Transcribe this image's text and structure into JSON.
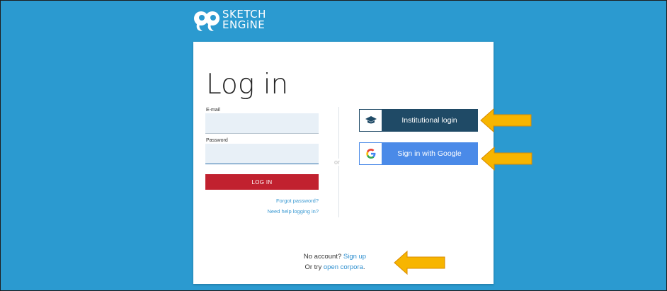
{
  "brand": {
    "line1": "SKETCH",
    "line2": "ENGiNE"
  },
  "login": {
    "title": "Log in",
    "email_label": "E-mail",
    "email_value": "",
    "password_label": "Password",
    "password_value": "",
    "submit_label": "LOG IN",
    "forgot_label": "Forgot password?",
    "help_label": "Need help logging in?"
  },
  "divider_or": "or",
  "sso": {
    "institutional_label": "Institutional login",
    "google_label": "Sign in with Google"
  },
  "footer": {
    "no_account_prefix": "No account?",
    "sign_up_label": "Sign up",
    "try_prefix": "Or try",
    "open_corpora_label": "open corpora",
    "try_suffix": "."
  },
  "colors": {
    "background": "#2b9ad0",
    "login_button": "#c1212f",
    "institutional_button": "#1f4a66",
    "google_button": "#4a8ae8",
    "arrow_fill": "#f7b500",
    "link": "#2e8fcf"
  },
  "icons": {
    "logo": "sketch-engine-logo",
    "institutional": "graduation-cap-icon",
    "google": "google-g-icon",
    "annotation": "arrow-left-icon"
  }
}
